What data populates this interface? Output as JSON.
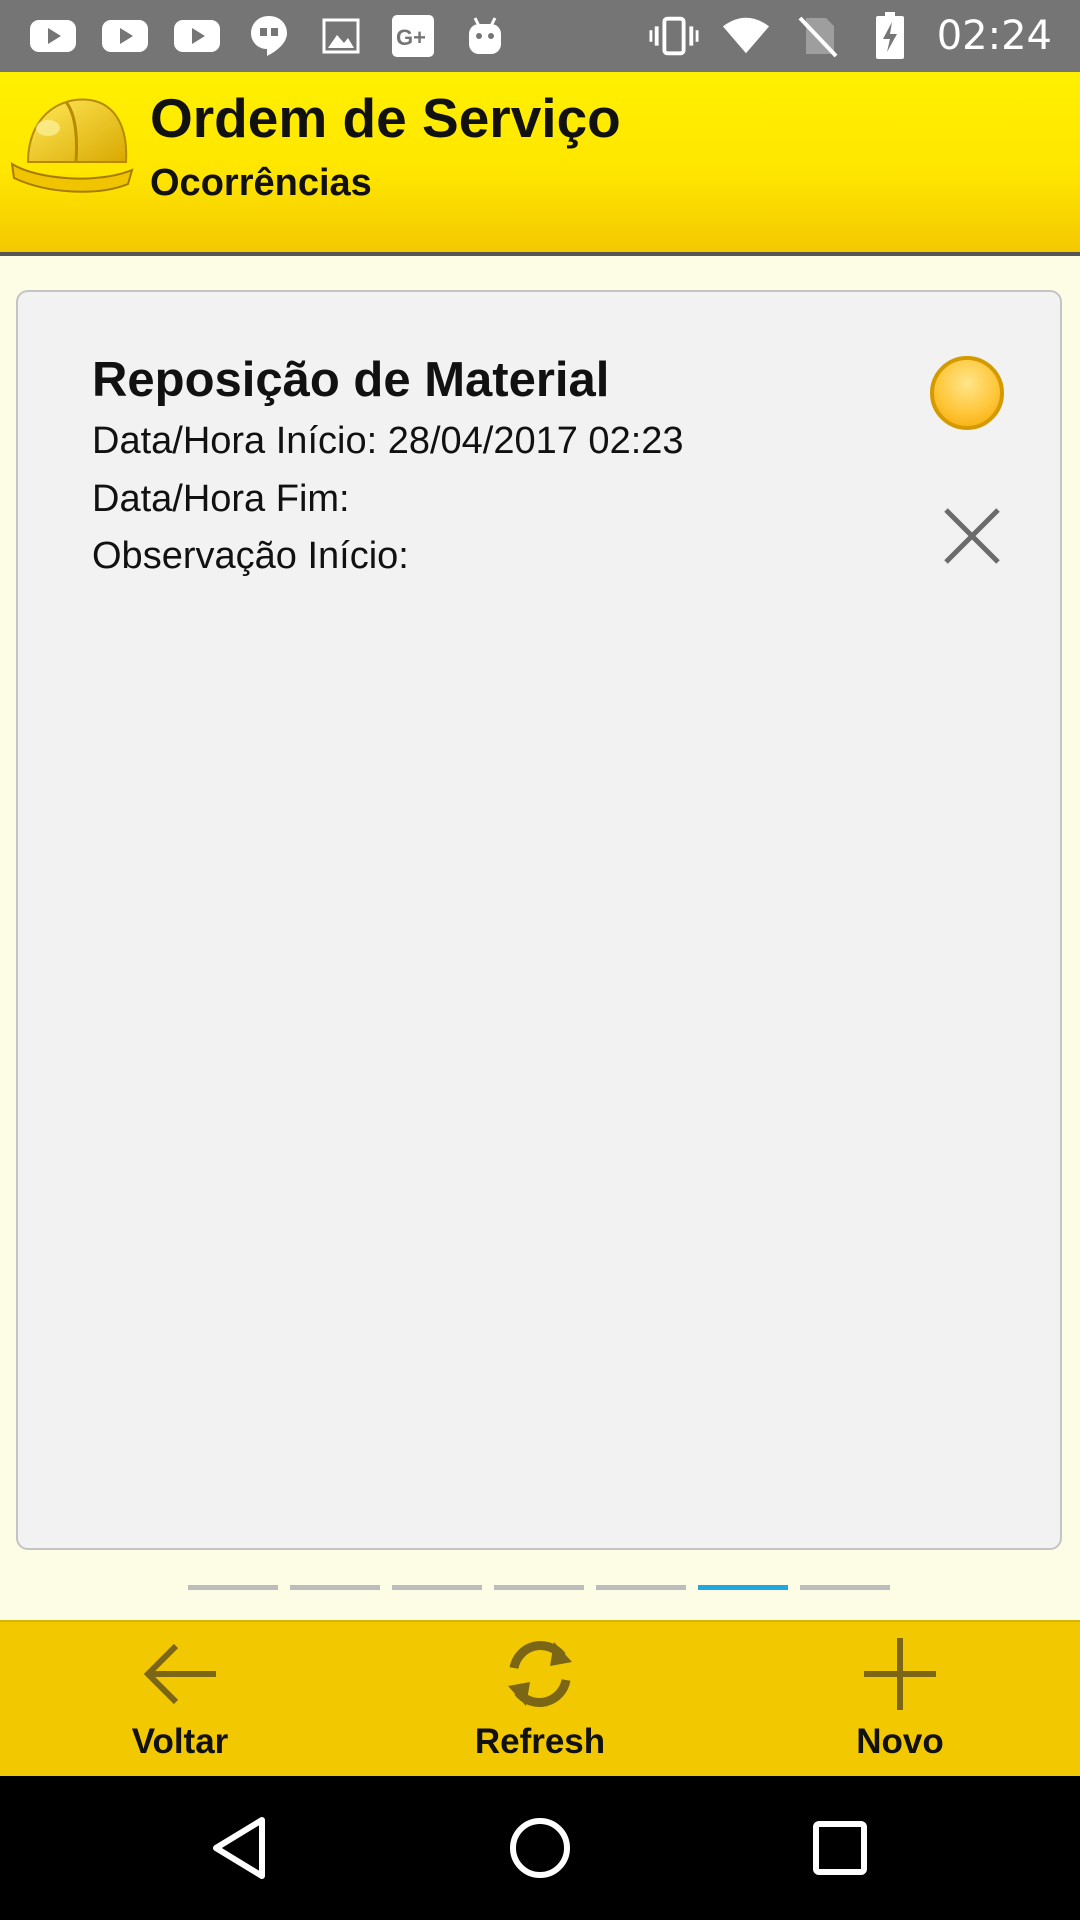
{
  "status_bar": {
    "time": "02:24",
    "left_icons": [
      "youtube-icon",
      "youtube-icon",
      "youtube-icon",
      "hangouts-icon",
      "image-icon",
      "google-plus-icon",
      "android-icon"
    ],
    "right_icons": [
      "vibrate-icon",
      "wifi-icon",
      "no-sim-icon",
      "battery-charging-icon"
    ]
  },
  "header": {
    "title": "Ordem de Serviço",
    "subtitle": "Ocorrências",
    "logo_icon": "hard-hat-icon"
  },
  "card": {
    "title": "Reposição de Material",
    "start_line": "Data/Hora Início: 28/04/2017 02:23",
    "end_line": "Data/Hora Fim:",
    "obs_line": "Observação Início:",
    "status_color": "#ffc73a"
  },
  "pager": {
    "count": 7,
    "active_index": 5,
    "active_color": "#1ea7e1"
  },
  "toolbar": {
    "back_label": "Voltar",
    "refresh_label": "Refresh",
    "new_label": "Novo"
  },
  "colors": {
    "header_yellow": "#ffe600",
    "toolbar_yellow": "#f2c800",
    "icon_olive": "#7a6614"
  }
}
